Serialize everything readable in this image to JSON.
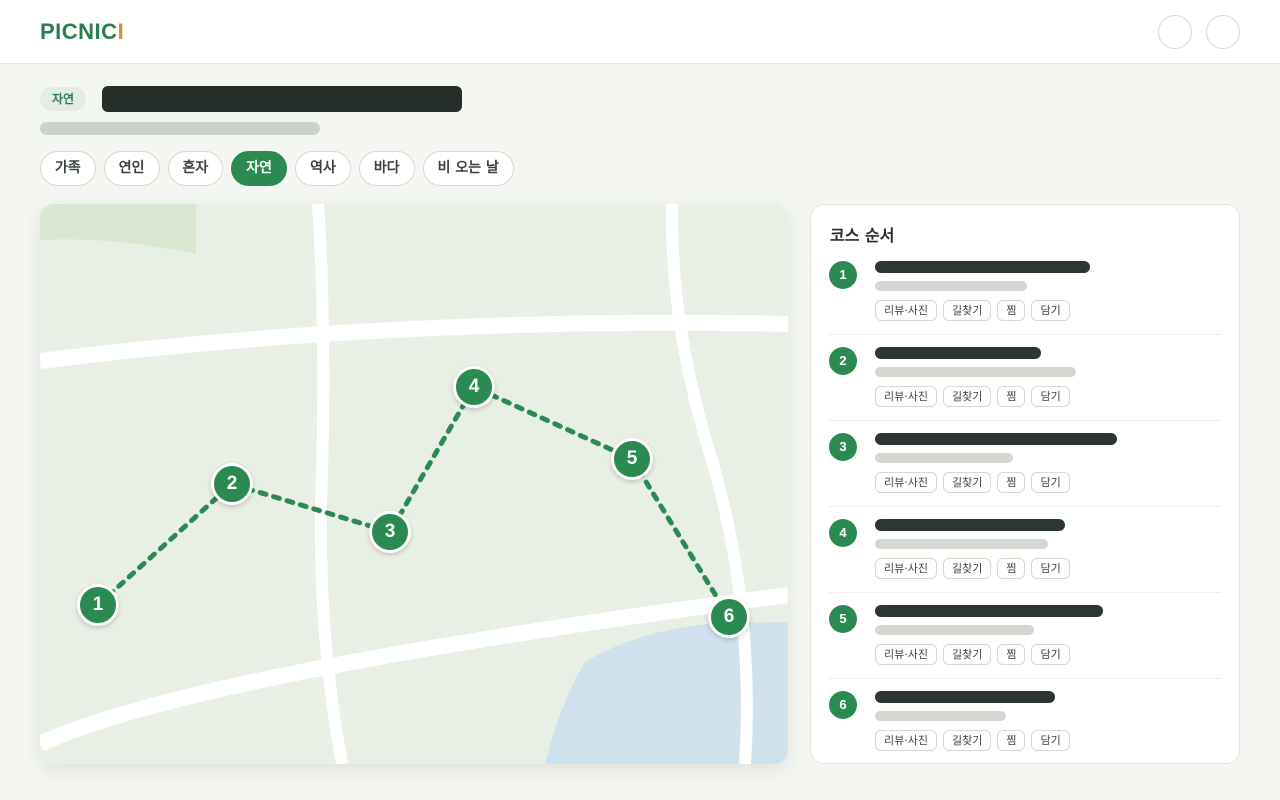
{
  "app": {
    "logo_main": "PICNIC",
    "logo_accent": "I"
  },
  "header": {
    "buttons": [
      "account",
      "menu"
    ]
  },
  "course": {
    "category": "자연"
  },
  "filters": [
    {
      "label": "가족",
      "active": false
    },
    {
      "label": "연인",
      "active": false
    },
    {
      "label": "혼자",
      "active": false
    },
    {
      "label": "자연",
      "active": true
    },
    {
      "label": "역사",
      "active": false
    },
    {
      "label": "바다",
      "active": false
    },
    {
      "label": "비 오는 날",
      "active": false
    }
  ],
  "map": {
    "markers": [
      "1",
      "2",
      "3",
      "4",
      "5",
      "6"
    ]
  },
  "panel": {
    "title": "코스 순서",
    "items": [
      {
        "number": "1",
        "actions": [
          "리뷰·사진",
          "길찾기",
          "찜",
          "담기"
        ]
      },
      {
        "number": "2",
        "actions": [
          "리뷰·사진",
          "길찾기",
          "찜",
          "담기"
        ]
      },
      {
        "number": "3",
        "actions": [
          "리뷰·사진",
          "길찾기",
          "찜",
          "담기"
        ]
      },
      {
        "number": "4",
        "actions": [
          "리뷰·사진",
          "길찾기",
          "찜",
          "담기"
        ]
      },
      {
        "number": "5",
        "actions": [
          "리뷰·사진",
          "길찾기",
          "찜",
          "담기"
        ]
      },
      {
        "number": "6",
        "actions": [
          "리뷰·사진",
          "길찾기",
          "찜",
          "담기"
        ]
      }
    ]
  },
  "colors": {
    "brand": "#2b8a52",
    "accent": "#e08a34",
    "map_land": "#e8efe4",
    "map_water": "#cfe1ec",
    "map_park": "#d7e7d0"
  }
}
